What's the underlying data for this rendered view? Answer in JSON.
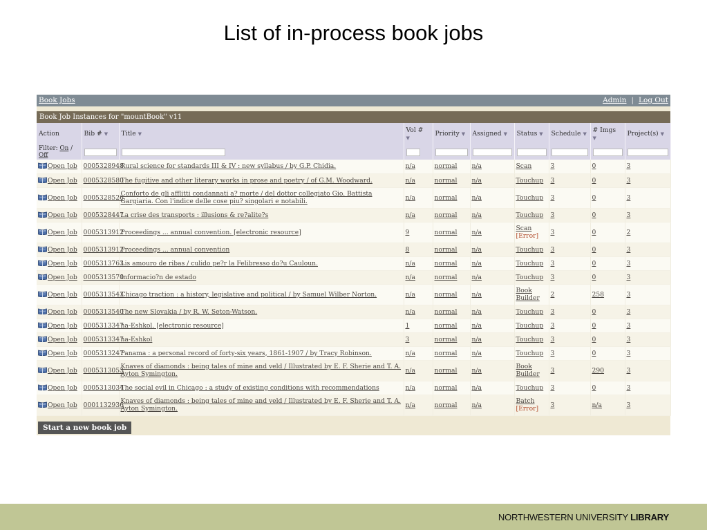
{
  "slide_title": "List of in-process book jobs",
  "nav": {
    "left": "Book Jobs",
    "admin": "Admin",
    "sep": "|",
    "logout": "Log Out"
  },
  "panel_title": "Book Job Instances for \"mountBook\" v11",
  "columns": {
    "action": "Action",
    "bib": "Bib #",
    "title": "Title",
    "vol": "Vol #",
    "priority": "Priority",
    "assigned": "Assigned",
    "status": "Status",
    "schedule": "Schedule",
    "imgs": "# Imgs",
    "projects": "Project(s)"
  },
  "sort_arrow": "▼",
  "filter": {
    "label": "Filter:",
    "on": "On",
    "slash": "/",
    "off": "Off"
  },
  "rows": [
    {
      "action": "Open Job",
      "bib": "0005328948",
      "title": "Rural science for standards III & IV : new syllabus / by G.P. Chidia.",
      "vol": "n/a",
      "priority": "normal",
      "assigned": "n/a",
      "status": "Scan",
      "status2": "",
      "schedule": "3",
      "imgs": "0",
      "projects": "3"
    },
    {
      "action": "Open Job",
      "bib": "0005328580",
      "title": "The fugitive and other literary works in prose and poetry / of G.M. Woodward.",
      "vol": "n/a",
      "priority": "normal",
      "assigned": "n/a",
      "status": "Touchup",
      "status2": "",
      "schedule": "3",
      "imgs": "0",
      "projects": "3"
    },
    {
      "action": "Open Job",
      "bib": "0005328526",
      "title": "Conforto de gli afflitti condannati a? morte / del dottor collegiato Gio. Battista Gargiaria. Con l'indice delle cose piu? singolari e notabili.",
      "vol": "n/a",
      "priority": "normal",
      "assigned": "n/a",
      "status": "Touchup",
      "status2": "",
      "schedule": "3",
      "imgs": "0",
      "projects": "3"
    },
    {
      "action": "Open Job",
      "bib": "0005328447",
      "title": "La crise des transports : illusions & re?alite?s",
      "vol": "n/a",
      "priority": "normal",
      "assigned": "n/a",
      "status": "Touchup",
      "status2": "",
      "schedule": "3",
      "imgs": "0",
      "projects": "3"
    },
    {
      "action": "Open Job",
      "bib": "0005313912",
      "title": "Proceedings ... annual convention. [electronic resource]",
      "vol": "9",
      "priority": "normal",
      "assigned": "n/a",
      "status": "Scan",
      "status2": "[Error]",
      "schedule": "3",
      "imgs": "0",
      "projects": "2"
    },
    {
      "action": "Open Job",
      "bib": "0005313912",
      "title": "Proceedings ... annual convention",
      "vol": "8",
      "priority": "normal",
      "assigned": "n/a",
      "status": "Touchup",
      "status2": "",
      "schedule": "3",
      "imgs": "0",
      "projects": "3"
    },
    {
      "action": "Open Job",
      "bib": "0005313763",
      "title": "Lis amouro de ribas / culido pe?r la Felibresso do?u Cauloun.",
      "vol": "n/a",
      "priority": "normal",
      "assigned": "n/a",
      "status": "Touchup",
      "status2": "",
      "schedule": "3",
      "imgs": "0",
      "projects": "3"
    },
    {
      "action": "Open Job",
      "bib": "0005313570",
      "title": "Informacio?n de estado",
      "vol": "n/a",
      "priority": "normal",
      "assigned": "n/a",
      "status": "Touchup",
      "status2": "",
      "schedule": "3",
      "imgs": "0",
      "projects": "3"
    },
    {
      "action": "Open Job",
      "bib": "0005313543",
      "title": "Chicago traction : a history, legislative and political / by Samuel Wilber Norton.",
      "vol": "n/a",
      "priority": "normal",
      "assigned": "n/a",
      "status": "Book",
      "status2": "Builder",
      "schedule": "2",
      "imgs": "258",
      "projects": "3"
    },
    {
      "action": "Open Job",
      "bib": "0005313540",
      "title": "The new Slovakia / by R. W. Seton-Watson.",
      "vol": "n/a",
      "priority": "normal",
      "assigned": "n/a",
      "status": "Touchup",
      "status2": "",
      "schedule": "3",
      "imgs": "0",
      "projects": "3"
    },
    {
      "action": "Open Job",
      "bib": "0005313347",
      "title": "ha-Eshkol. [electronic resource]",
      "vol": "1",
      "priority": "normal",
      "assigned": "n/a",
      "status": "Touchup",
      "status2": "",
      "schedule": "3",
      "imgs": "0",
      "projects": "3"
    },
    {
      "action": "Open Job",
      "bib": "0005313347",
      "title": "ha-Eshkol",
      "vol": "3",
      "priority": "normal",
      "assigned": "n/a",
      "status": "Touchup",
      "status2": "",
      "schedule": "3",
      "imgs": "0",
      "projects": "3"
    },
    {
      "action": "Open Job",
      "bib": "0005313247",
      "title": "Panama : a personal record of forty-six years, 1861-1907 / by Tracy Robinson.",
      "vol": "n/a",
      "priority": "normal",
      "assigned": "n/a",
      "status": "Touchup",
      "status2": "",
      "schedule": "3",
      "imgs": "0",
      "projects": "3"
    },
    {
      "action": "Open Job",
      "bib": "0005313053",
      "title": "Knaves of diamonds : being tales of mine and veld / Illustrated by E. F. Sherie and T. A. Ayton Symington.",
      "vol": "n/a",
      "priority": "normal",
      "assigned": "n/a",
      "status": "Book",
      "status2": "Builder",
      "schedule": "3",
      "imgs": "290",
      "projects": "3"
    },
    {
      "action": "Open Job",
      "bib": "0005313034",
      "title": "The social evil in Chicago : a study of existing conditions with recommendations",
      "vol": "n/a",
      "priority": "normal",
      "assigned": "n/a",
      "status": "Touchup",
      "status2": "",
      "schedule": "3",
      "imgs": "0",
      "projects": "3"
    },
    {
      "action": "Open Job",
      "bib": "0001132936",
      "title": "Knaves of diamonds : being tales of mine and veld / Illustrated by E. F. Sherie and T. A. Ayton Symington.",
      "vol": "n/a",
      "priority": "normal",
      "assigned": "n/a",
      "status": "Batch",
      "status2": "[Error]",
      "schedule": "3",
      "imgs": "n/a",
      "projects": "3"
    }
  ],
  "start_button": "Start a new book job",
  "footer": {
    "brand_regular": "NORTHWESTERN UNIVERSITY ",
    "brand_bold": "LIBRARY"
  },
  "colors": {
    "topbar": "#7f8b94",
    "panel_head": "#766b57",
    "header_bg": "#d9d6e7",
    "footer": "#c0c695",
    "error": "#b04a2a"
  }
}
